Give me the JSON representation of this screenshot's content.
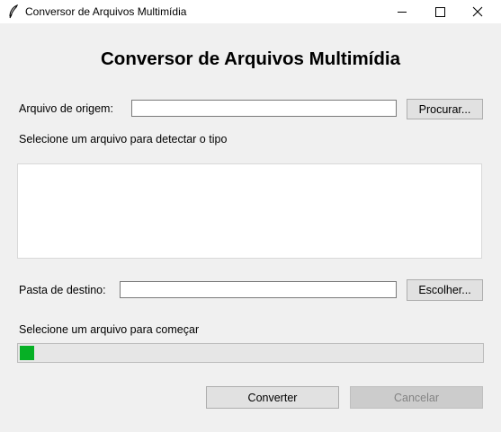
{
  "window": {
    "title": "Conversor de Arquivos Multimídia",
    "controls": [
      "minimize-icon",
      "maximize-icon",
      "close-icon"
    ]
  },
  "heading": "Conversor de Arquivos Multimídia",
  "source": {
    "label": "Arquivo de origem:",
    "value": "",
    "browse_label": "Procurar...",
    "detect_status": "Selecione um arquivo para detectar o tipo"
  },
  "info_box": {
    "text": ""
  },
  "destination": {
    "label": "Pasta de destino:",
    "value": "",
    "choose_label": "Escolher..."
  },
  "progress": {
    "status": "Selecione um arquivo para começar",
    "fraction": 0.03,
    "color": "#06b025"
  },
  "actions": {
    "convert_label": "Converter",
    "cancel_label": "Cancelar",
    "cancel_enabled": false
  }
}
